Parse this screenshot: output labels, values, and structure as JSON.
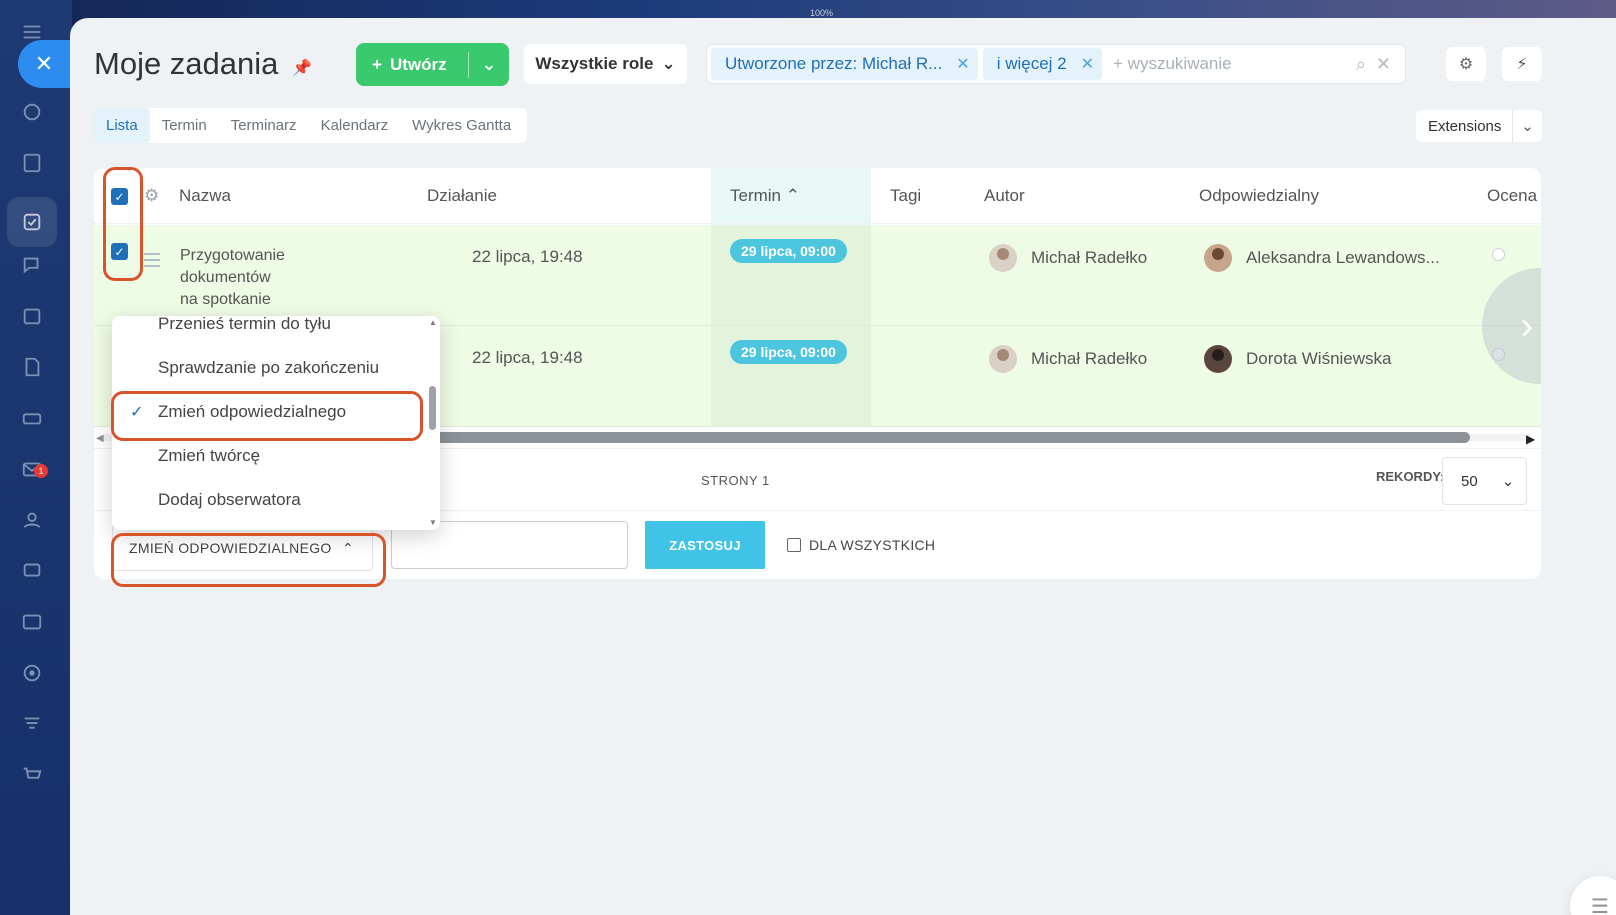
{
  "topbar": {
    "zoom": "100%"
  },
  "header": {
    "title": "Moje zadania",
    "create_label": "Utwórz",
    "roles_label": "Wszystkie role",
    "filter_chips": [
      "Utworzone przez: Michał R...",
      "i więcej 2"
    ],
    "search_placeholder": "+ wyszukiwanie"
  },
  "tabs": [
    "Lista",
    "Termin",
    "Terminarz",
    "Kalendarz",
    "Wykres Gantta"
  ],
  "extensions_label": "Extensions",
  "columns": [
    "Nazwa",
    "Działanie",
    "Termin",
    "Tagi",
    "Autor",
    "Odpowiedzialny",
    "Ocena"
  ],
  "rows": [
    {
      "name_lines": [
        "Przygotowanie",
        "dokumentów",
        "na spotkanie"
      ],
      "activity": "22 lipca, 19:48",
      "deadline": "29 lipca, 09:00",
      "author": "Michał Radełko",
      "responsible": "Aleksandra Lewandows..."
    },
    {
      "name_lines": [],
      "activity": "22 lipca, 19:48",
      "deadline": "29 lipca, 09:00",
      "author": "Michał Radełko",
      "responsible": "Dorota Wiśniewska"
    }
  ],
  "pager": {
    "pages_label": "STRONY 1",
    "records_label": "REKORDY:",
    "records_value": "50"
  },
  "action_bar": {
    "selected_action": "ZMIEŃ ODPOWIEDZIALNEGO",
    "apply_label": "ZASTOSUJ",
    "for_all_label": "DLA WSZYSTKICH"
  },
  "dropdown": {
    "items": [
      "Przenieś termin do tyłu",
      "Sprawdzanie po zakończeniu",
      "Zmień odpowiedzialnego",
      "Zmień twórcę",
      "Dodaj obserwatora"
    ],
    "selected": "Zmień odpowiedzialnego"
  },
  "rail_badge": "1",
  "colors": {
    "accent": "#1f70b8",
    "create": "#3bc96d",
    "apply": "#3fc3e6",
    "highlight": "#d9542b",
    "row_bg": "#eefbe5",
    "deadline": "#4cc5de"
  }
}
